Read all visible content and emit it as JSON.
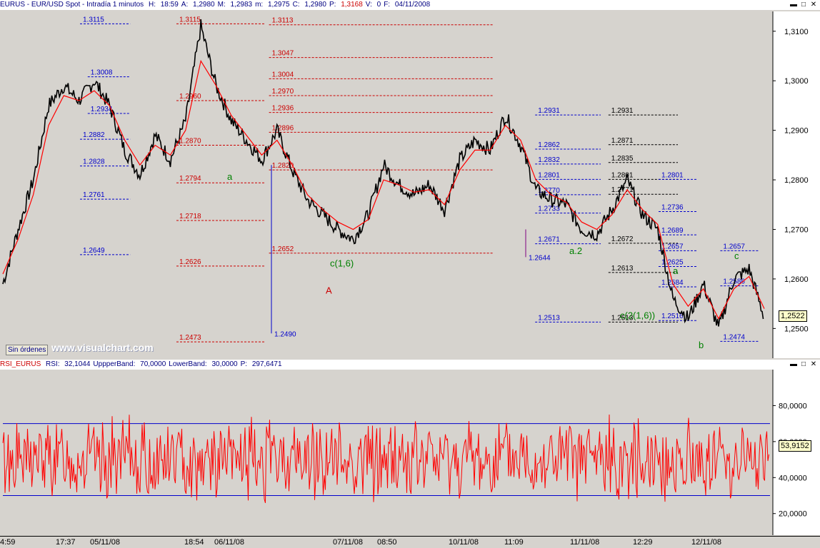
{
  "price_pane": {
    "title_symbol": "EURUS - EUR/USD Spot - Intradía 1 minutos",
    "fields": [
      {
        "label": "H:",
        "value": "18:59",
        "color": "#000080"
      },
      {
        "label": "A:",
        "value": "1,2980",
        "color": "#000080"
      },
      {
        "label": "M:",
        "value": "1,2983",
        "color": "#000080"
      },
      {
        "label": "m:",
        "value": "1,2975",
        "color": "#000080"
      },
      {
        "label": "C:",
        "value": "1,2980",
        "color": "#000080"
      },
      {
        "label": "P:",
        "value": "1,3168",
        "color": "#cc0000"
      },
      {
        "label": "V:",
        "value": "0",
        "color": "#000080"
      },
      {
        "label": "F:",
        "value": "04/11/2008",
        "color": "#000080"
      }
    ],
    "last_price_badge": "1,2522",
    "sin_ordenes": "Sin órdenes",
    "watermark": "www.visualchart.com"
  },
  "rsi_pane": {
    "title": "RSI_EURUS",
    "fields": [
      {
        "label": "RSI:",
        "value": "32,1044"
      },
      {
        "label": "UppperBand:",
        "value": "70,0000"
      },
      {
        "label": "LowerBand:",
        "value": "30,0000"
      },
      {
        "label": "P:",
        "value": "297,6471"
      }
    ],
    "last_value_badge": "53,9152"
  },
  "x_axis_labels": [
    "4:59",
    "17:37",
    "05/11/08",
    "18:54",
    "06/11/08",
    "07/11/08",
    "08:50",
    "10/11/08",
    "11:09",
    "11/11/08",
    "12:29",
    "12/11/08"
  ],
  "chart_data": [
    {
      "type": "line",
      "name": "price",
      "y_tick_labels": [
        "1,3100",
        "1,3000",
        "1,2900",
        "1,2800",
        "1,2700",
        "1,2600",
        "1,2500"
      ],
      "ylim": [
        1.244,
        1.314
      ],
      "colors": {
        "price": "#000000",
        "moving_average": "#ff0000",
        "fib_blue": "#0000cc",
        "fib_red": "#cc0000",
        "fib_black": "#000000",
        "wave_label": "#008000"
      },
      "x": [
        0,
        2,
        4,
        6,
        8,
        10,
        12,
        14,
        16,
        18,
        20,
        22,
        24,
        26,
        28,
        30,
        32,
        34,
        36,
        38,
        40,
        42,
        44,
        46,
        48,
        50,
        52,
        54,
        56,
        58,
        60,
        62,
        64,
        66,
        68,
        70,
        72,
        74,
        76,
        78,
        80,
        82,
        84,
        86,
        88,
        90,
        92,
        94,
        96,
        98,
        100
      ],
      "close": [
        1.259,
        1.27,
        1.28,
        1.295,
        1.299,
        1.296,
        1.3,
        1.295,
        1.286,
        1.281,
        1.289,
        1.284,
        1.292,
        1.311,
        1.299,
        1.292,
        1.288,
        1.284,
        1.29,
        1.282,
        1.276,
        1.273,
        1.27,
        1.268,
        1.273,
        1.283,
        1.279,
        1.277,
        1.279,
        1.274,
        1.284,
        1.288,
        1.286,
        1.293,
        1.287,
        1.278,
        1.276,
        1.275,
        1.27,
        1.269,
        1.274,
        1.28,
        1.273,
        1.27,
        1.256,
        1.252,
        1.259,
        1.25,
        1.26,
        1.262,
        1.2522
      ],
      "ma": [
        1.261,
        1.268,
        1.277,
        1.291,
        1.297,
        1.296,
        1.298,
        1.295,
        1.288,
        1.283,
        1.287,
        1.285,
        1.29,
        1.304,
        1.299,
        1.293,
        1.289,
        1.285,
        1.288,
        1.283,
        1.277,
        1.274,
        1.2715,
        1.27,
        1.272,
        1.28,
        1.279,
        1.2775,
        1.278,
        1.275,
        1.282,
        1.286,
        1.286,
        1.291,
        1.288,
        1.28,
        1.277,
        1.2755,
        1.2715,
        1.27,
        1.273,
        1.278,
        1.274,
        1.271,
        1.259,
        1.2545,
        1.258,
        1.252,
        1.258,
        1.2605,
        1.254
      ],
      "fib_levels": [
        {
          "label": "1.3115",
          "color": "blue",
          "x0": 20,
          "x1": 33,
          "y": 1.3115
        },
        {
          "label": "1.3008",
          "color": "blue",
          "x0": 22,
          "x1": 33,
          "y": 1.3008
        },
        {
          "label": "1.2934",
          "color": "blue",
          "x0": 22,
          "x1": 33,
          "y": 1.2934
        },
        {
          "label": "1.2882",
          "color": "blue",
          "x0": 20,
          "x1": 33,
          "y": 1.2882
        },
        {
          "label": "1.2828",
          "color": "blue",
          "x0": 20,
          "x1": 33,
          "y": 1.2828
        },
        {
          "label": "1.2761",
          "color": "blue",
          "x0": 20,
          "x1": 33,
          "y": 1.2761
        },
        {
          "label": "1.2649",
          "color": "blue",
          "x0": 20,
          "x1": 33,
          "y": 1.2649
        },
        {
          "label": "1.3115",
          "color": "red",
          "x0": 45,
          "x1": 68,
          "y": 1.3115
        },
        {
          "label": "1.2960",
          "color": "red",
          "x0": 45,
          "x1": 68,
          "y": 1.296
        },
        {
          "label": "1.2870",
          "color": "red",
          "x0": 45,
          "x1": 68,
          "y": 1.287
        },
        {
          "label": "1.2794",
          "color": "red",
          "x0": 45,
          "x1": 68,
          "y": 1.2794
        },
        {
          "label": "1.2718",
          "color": "red",
          "x0": 45,
          "x1": 68,
          "y": 1.2718
        },
        {
          "label": "1.2626",
          "color": "red",
          "x0": 45,
          "x1": 68,
          "y": 1.2626
        },
        {
          "label": "1.2473",
          "color": "red",
          "x0": 45,
          "x1": 68,
          "y": 1.2473
        },
        {
          "label": "1.3113",
          "color": "red",
          "x0": 69,
          "x1": 127,
          "y": 1.3113
        },
        {
          "label": "1.3047",
          "color": "red",
          "x0": 69,
          "x1": 127,
          "y": 1.3047
        },
        {
          "label": "1.3004",
          "color": "red",
          "x0": 69,
          "x1": 127,
          "y": 1.3004
        },
        {
          "label": "1.2970",
          "color": "red",
          "x0": 69,
          "x1": 127,
          "y": 1.297
        },
        {
          "label": "1.2936",
          "color": "red",
          "x0": 69,
          "x1": 127,
          "y": 1.2936
        },
        {
          "label": "1.2896",
          "color": "red",
          "x0": 69,
          "x1": 127,
          "y": 1.2896
        },
        {
          "label": "1.2820",
          "color": "red",
          "x0": 69,
          "x1": 127,
          "y": 1.282
        },
        {
          "label": "1.2652",
          "color": "red",
          "x0": 69,
          "x1": 127,
          "y": 1.2652
        },
        {
          "label": "1.2931",
          "color": "blue",
          "x0": 138,
          "x1": 155,
          "y": 1.2931
        },
        {
          "label": "1.2862",
          "color": "blue",
          "x0": 138,
          "x1": 155,
          "y": 1.2862
        },
        {
          "label": "1.2832",
          "color": "blue",
          "x0": 138,
          "x1": 155,
          "y": 1.2832
        },
        {
          "label": "1.2801",
          "color": "blue",
          "x0": 138,
          "x1": 155,
          "y": 1.2801
        },
        {
          "label": "1.2770",
          "color": "blue",
          "x0": 138,
          "x1": 155,
          "y": 1.277
        },
        {
          "label": "1.2733",
          "color": "blue",
          "x0": 138,
          "x1": 155,
          "y": 1.2733
        },
        {
          "label": "1.2671",
          "color": "blue",
          "x0": 138,
          "x1": 155,
          "y": 1.2671
        },
        {
          "label": "1.2513",
          "color": "blue",
          "x0": 138,
          "x1": 155,
          "y": 1.2513
        },
        {
          "label": "1.2931",
          "color": "black",
          "x0": 157,
          "x1": 175,
          "y": 1.2931
        },
        {
          "label": "1.2871",
          "color": "black",
          "x0": 157,
          "x1": 175,
          "y": 1.2871
        },
        {
          "label": "1.2835",
          "color": "black",
          "x0": 157,
          "x1": 175,
          "y": 1.2835
        },
        {
          "label": "1.2801",
          "color": "black",
          "x0": 157,
          "x1": 175,
          "y": 1.2801
        },
        {
          "label": "1.2771",
          "color": "black",
          "x0": 157,
          "x1": 175,
          "y": 1.2771
        },
        {
          "label": "1.2672",
          "color": "black",
          "x0": 157,
          "x1": 175,
          "y": 1.2672
        },
        {
          "label": "1.2613",
          "color": "black",
          "x0": 157,
          "x1": 175,
          "y": 1.2613
        },
        {
          "label": "1.2513",
          "color": "black",
          "x0": 157,
          "x1": 175,
          "y": 1.2513
        },
        {
          "label": "1.2801",
          "color": "blue",
          "x0": 170,
          "x1": 180,
          "y": 1.2801
        },
        {
          "label": "1.2736",
          "color": "blue",
          "x0": 170,
          "x1": 180,
          "y": 1.2736
        },
        {
          "label": "1.2689",
          "color": "blue",
          "x0": 170,
          "x1": 180,
          "y": 1.2689
        },
        {
          "label": "1.2657",
          "color": "blue",
          "x0": 170,
          "x1": 180,
          "y": 1.2657
        },
        {
          "label": "1.2625",
          "color": "blue",
          "x0": 170,
          "x1": 180,
          "y": 1.2625
        },
        {
          "label": "1.2584",
          "color": "blue",
          "x0": 170,
          "x1": 180,
          "y": 1.2584
        },
        {
          "label": "1.2516",
          "color": "blue",
          "x0": 170,
          "x1": 180,
          "y": 1.2516
        },
        {
          "label": "1.2657",
          "color": "blue",
          "x0": 186,
          "x1": 196,
          "y": 1.2657
        },
        {
          "label": "1.2586",
          "color": "blue",
          "x0": 186,
          "x1": 196,
          "y": 1.2586
        },
        {
          "label": "1.2474",
          "color": "blue",
          "x0": 186,
          "x1": 196,
          "y": 1.2474
        }
      ],
      "point_labels": [
        {
          "text": "1.2490",
          "y": 1.249
        },
        {
          "text": "1.2644",
          "y": 1.2644
        }
      ],
      "wave_labels": [
        {
          "text": "a",
          "y": 1.28,
          "color": "#008000"
        },
        {
          "text": "c(1,6)",
          "y": 1.2625,
          "color": "#008000"
        },
        {
          "text": "A",
          "y": 1.257,
          "color": "#cc0000"
        },
        {
          "text": "a.2",
          "y": 1.265,
          "color": "#008000"
        },
        {
          "text": "c(2(1,6))",
          "y": 1.252,
          "color": "#008000"
        },
        {
          "text": "a",
          "y": 1.261,
          "color": "#008000"
        },
        {
          "text": "b",
          "y": 1.246,
          "color": "#008000"
        },
        {
          "text": "c",
          "y": 1.264,
          "color": "#008000"
        }
      ]
    },
    {
      "type": "line",
      "name": "RSI",
      "y_tick_labels": [
        "80,0000",
        "60,0000",
        "40,0000",
        "20,0000"
      ],
      "ylim": [
        8,
        100
      ],
      "bands": [
        70,
        30
      ],
      "colors": {
        "rsi": "#ff0000",
        "bands": "#0000cc"
      },
      "mean": 50,
      "amplitude": 20,
      "last": 53.9152
    }
  ]
}
